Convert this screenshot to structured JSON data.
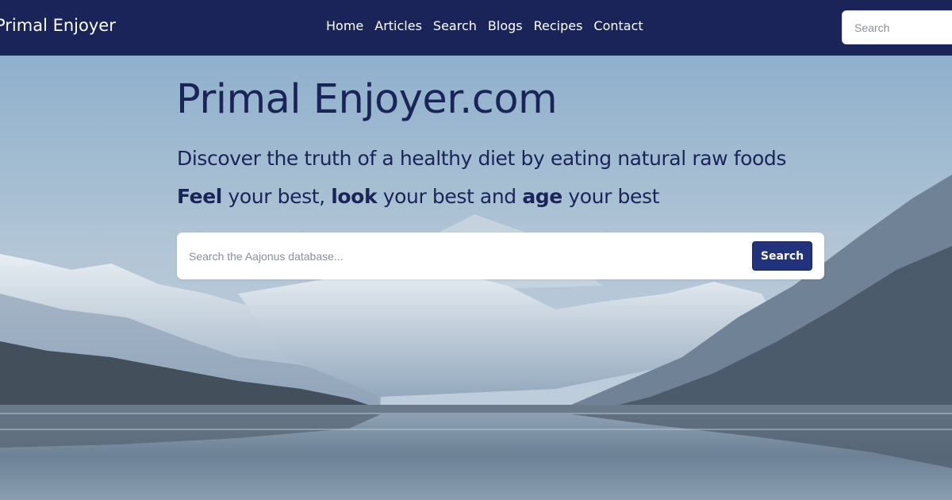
{
  "navbar": {
    "brand": "Primal Enjoyer",
    "links": [
      "Home",
      "Articles",
      "Search",
      "Blogs",
      "Recipes",
      "Contact"
    ],
    "search_placeholder": "Search"
  },
  "hero": {
    "title": "Primal Enjoyer.com",
    "subtitle": "Discover the truth of a healthy diet by eating natural raw foods",
    "tagline": {
      "w1": "Feel",
      "t1": " your best, ",
      "w2": "look",
      "t2": " your best and ",
      "w3": "age",
      "t3": " your best"
    },
    "search_placeholder": "Search the Aajonus database...",
    "search_button": "Search"
  },
  "colors": {
    "navbar_bg": "#1b2458",
    "text_primary": "#1b2458",
    "button_bg": "#22337e"
  },
  "background": "mountain-lake-landscape"
}
